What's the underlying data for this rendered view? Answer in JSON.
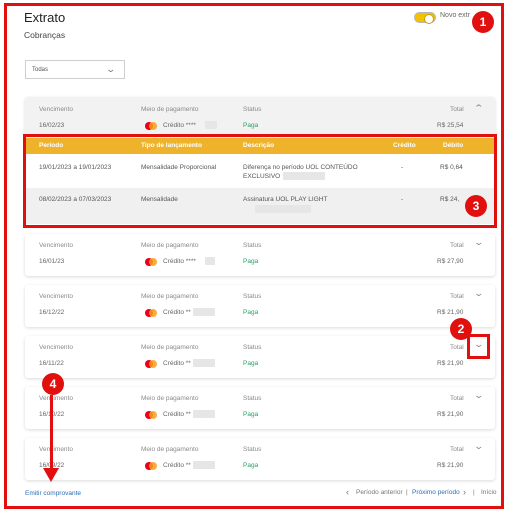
{
  "header": {
    "title": "Extrato",
    "subtitle": "Cobranças",
    "toggle_label": "Novo extr"
  },
  "filter": {
    "value": "Todas"
  },
  "columns": {
    "due": "Vencimento",
    "method": "Meio de pagamento",
    "status": "Status",
    "total": "Total"
  },
  "payments": [
    {
      "due": "16/02/23",
      "method": "Crédito ****",
      "status": "Paga",
      "total": "R$ 25,54",
      "expanded": true
    },
    {
      "due": "16/01/23",
      "method": "Crédito ****",
      "status": "Paga",
      "total": "R$ 27,90"
    },
    {
      "due": "16/12/22",
      "method": "Crédito **",
      "status": "Paga",
      "total": "R$ 21,90"
    },
    {
      "due": "16/11/22",
      "method": "Crédito **",
      "status": "Paga",
      "total": "R$ 21,90"
    },
    {
      "due": "16/10/22",
      "method": "Crédito **",
      "status": "Paga",
      "total": "R$ 21,90"
    },
    {
      "due": "16/09/22",
      "method": "Crédito **",
      "status": "Paga",
      "total": "R$ 21,90"
    }
  ],
  "detail": {
    "headers": {
      "period": "Período",
      "type": "Tipo de lançamento",
      "description": "Descrição",
      "credit": "Crédito",
      "debit": "Débito"
    },
    "rows": [
      {
        "period": "19/01/2023 a 19/01/2023",
        "type": "Mensalidade Proporcional",
        "desc1": "Diferença no período UOL CONTEÚDO",
        "desc2": "EXCLUSIVO",
        "credit": "-",
        "debit": "R$ 0,64"
      },
      {
        "period": "08/02/2023 a 07/03/2023",
        "type": "Mensalidade",
        "desc1": "Assinatura UOL PLAY LIGHT",
        "desc2": "",
        "credit": "-",
        "debit": "R$ 24,"
      }
    ]
  },
  "annotations": {
    "b1": "1",
    "b2": "2",
    "b3": "3",
    "b4": "4"
  },
  "footer": {
    "receipt": "Emitir comprovante",
    "prev": "Período anterior",
    "next": "Próximo período",
    "start": "Início",
    "prev_arrow": "‹",
    "next_arrow": "›",
    "sep": "|"
  },
  "colors": {
    "annotation_red": "#e20f0f",
    "table_header": "#eeb32b",
    "paid_green": "#2a9d62",
    "link_blue": "#2d6db5"
  }
}
